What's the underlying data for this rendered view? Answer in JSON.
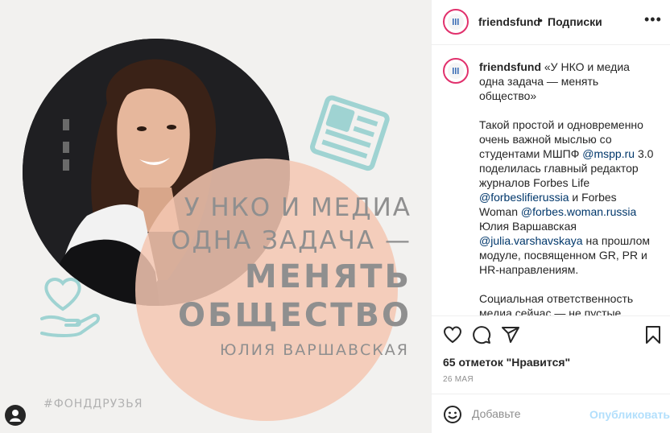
{
  "image": {
    "headline_line1": "У НКО И МЕДИА",
    "headline_line2": "ОДНА ЗАДАЧА —",
    "headline_line3": "МЕНЯТЬ",
    "headline_line4": "ОБЩЕСТВО",
    "author": "ЮЛИЯ ВАРШАВСКАЯ",
    "hashtag": "#ФОНДДРУЗЬЯ",
    "colors": {
      "background": "#f2f1ef",
      "peach": "#f4c7b2",
      "teal": "#9fd3d2",
      "text": "#8f8f8f"
    }
  },
  "header": {
    "username": "friendsfund",
    "separator": "•",
    "follow_label": "Подписки",
    "more_icon": "more-horizontal-icon"
  },
  "caption": {
    "username": "friendsfund",
    "p1": [
      {
        "t": "«У НКО и медиа одна задача — менять общество»",
        "m": false
      }
    ],
    "p2": [
      {
        "t": "Такой простой и одновременно очень важной мыслью со студентами МШПФ ",
        "m": false
      },
      {
        "t": "@mspp.ru",
        "m": true
      },
      {
        "t": " 3.0 поделилась главный редактор журналов Forbes Life ",
        "m": false
      },
      {
        "t": "@forbeslifierussia",
        "m": true
      },
      {
        "t": " и Forbes Woman ",
        "m": false
      },
      {
        "t": "@forbes.woman.russia",
        "m": true
      },
      {
        "t": " Юлия Варшавская ",
        "m": false
      },
      {
        "t": "@julia.varshavskaya",
        "m": true
      },
      {
        "t": " на прошлом модуле, посвященном GR, PR и HR-направлениям.",
        "m": false
      }
    ],
    "p3": [
      {
        "t": "Социальная ответственность медиа сейчас — не пустые слова. Все чаще на страницах популярных изданий можно встретить статьи, посвященные остро-социальным",
        "m": false
      }
    ]
  },
  "actions": {
    "like_icon": "heart-outline-icon",
    "comment_icon": "comment-bubble-icon",
    "share_icon": "paper-plane-icon",
    "save_icon": "bookmark-icon"
  },
  "likes_text": "65 отметок \"Нравится\"",
  "date": "26 МАЯ",
  "comment_box": {
    "emoji_icon": "smiley-icon",
    "placeholder": "Добавьте",
    "post_label": "Опубликовать",
    "post_color": "#b2dffc"
  }
}
